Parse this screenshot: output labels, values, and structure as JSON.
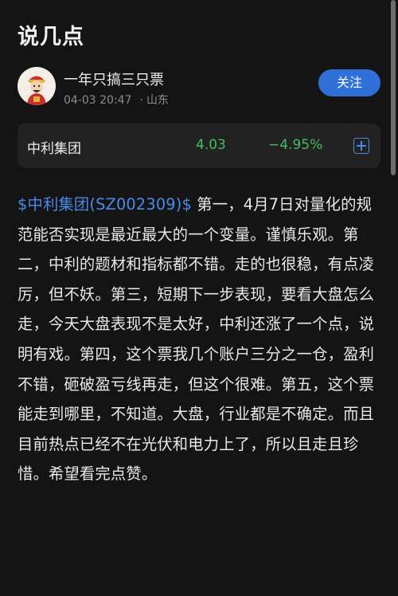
{
  "page": {
    "title": "说几点"
  },
  "author": {
    "name": "一年只搞三只票",
    "date": "04-03 20:47",
    "separator": "·",
    "location": "山东",
    "follow_label": "关注"
  },
  "stock": {
    "name": "中利集团",
    "price": "4.03",
    "change": "−4.95%",
    "color": "#3fbf5f"
  },
  "post": {
    "ticker_link": "$中利集团(SZ002309)$",
    "text": " 第一，4月7日对量化的规范能否实现是最近最大的一个变量。谨慎乐观。第二，中利的题材和指标都不错。走的也很稳，有点凌厉，但不妖。第三，短期下一步表现，要看大盘怎么走，今天大盘表现不是太好，中利还涨了一个点，说明有戏。第四，这个票我几个账户三分之一仓，盈利不错，砸破盈亏线再走，但这个很难。第五，这个票能走到哪里，不知道。大盘，行业都是不确定。而且目前热点已经不在光伏和电力上了，所以且走且珍惜。希望看完点赞。"
  },
  "colors": {
    "accent": "#2f6fd8",
    "link": "#4a8ae8",
    "background": "#141414"
  }
}
